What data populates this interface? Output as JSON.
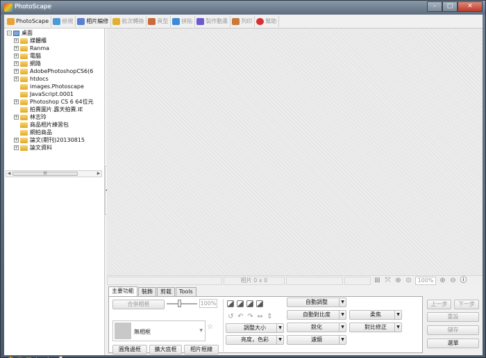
{
  "window": {
    "title": "PhotoScape",
    "min_label": "–",
    "max_label": "□",
    "close_label": "✕"
  },
  "tabs": [
    {
      "label": "PhotoScape",
      "color": "#e8a23a"
    },
    {
      "label": "檢視",
      "color": "#4a9ad8"
    },
    {
      "label": "相片編修",
      "color": "#5a7fd0"
    },
    {
      "label": "批次轉換",
      "color": "#e0b030"
    },
    {
      "label": "頁型",
      "color": "#c86a3a"
    },
    {
      "label": "拼貼",
      "color": "#3a8ad8"
    },
    {
      "label": "製作動畫",
      "color": "#6a5ad0"
    },
    {
      "label": "列印",
      "color": "#c87a3a"
    },
    {
      "label": "幫助",
      "color": "#d83030"
    }
  ],
  "tree": {
    "root": "桌面",
    "items": [
      {
        "label": "媒體櫃",
        "exp": "+"
      },
      {
        "label": "Ranma",
        "exp": "+"
      },
      {
        "label": "電腦",
        "exp": "+"
      },
      {
        "label": "網路",
        "exp": "+"
      },
      {
        "label": "AdobePhotoshopCS6(6",
        "exp": "+"
      },
      {
        "label": "htdocs",
        "exp": "+"
      },
      {
        "label": "images.Photoscape",
        "exp": ""
      },
      {
        "label": "JavaScript.0001",
        "exp": ""
      },
      {
        "label": "Photoshop CS 6 64位元",
        "exp": "+"
      },
      {
        "label": "拍賣圖片.露天拍賣.IE",
        "exp": ""
      },
      {
        "label": "林志玲",
        "exp": "+"
      },
      {
        "label": "商品相片練習包",
        "exp": ""
      },
      {
        "label": "網拍商品",
        "exp": ""
      },
      {
        "label": "論文(期刊)20130815",
        "exp": "+"
      },
      {
        "label": "論文資料",
        "exp": "+"
      }
    ],
    "scroll_thumb": "III"
  },
  "status": {
    "photo_size": "相片 0 x 0",
    "zoom": "100%"
  },
  "func_tabs": [
    "主要功能",
    "裝飾",
    "剪栽",
    "Tools"
  ],
  "panel": {
    "merge_frame": "合併相框",
    "pct": "100%",
    "frame_name": "無相框",
    "round_border": "圓角邊框",
    "expand_border": "擴大底框",
    "photo_border": "相片框線",
    "auto_level": "自動調整",
    "auto_contrast": "自動對比度",
    "resize": "調整大小",
    "sharpen": "銳化",
    "bright_color": "亮度，色彩",
    "filter": "濾鏡",
    "soften": "柔焦",
    "backlight": "對比修正",
    "undo": "上一步",
    "redo": "下一步",
    "reset": "重設",
    "save": "儲存",
    "menu": "選單"
  }
}
